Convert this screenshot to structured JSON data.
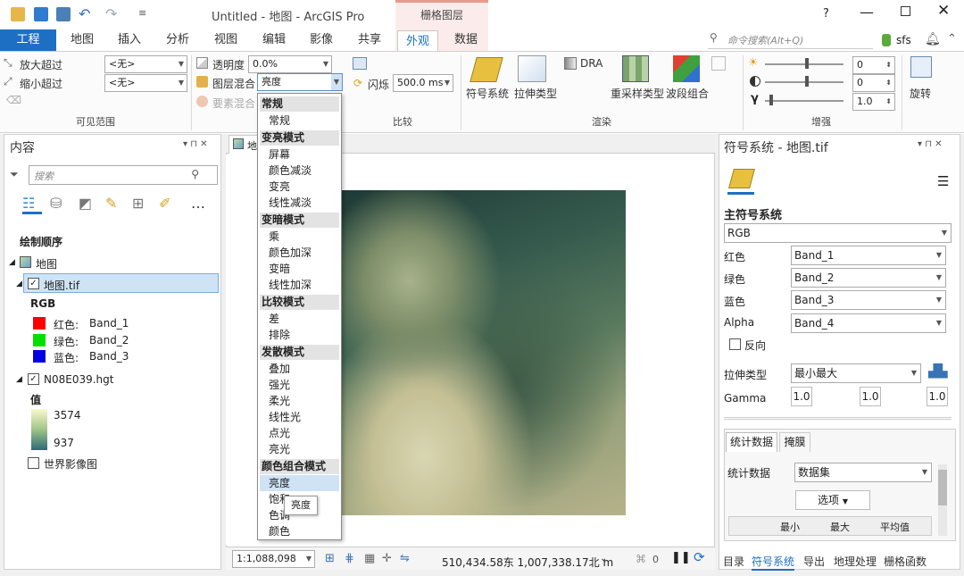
{
  "app": {
    "title": "Untitled - 地图 - ArcGIS Pro",
    "context_tab": "栅格图层",
    "help": "?"
  },
  "tabs": [
    "工程",
    "地图",
    "插入",
    "分析",
    "视图",
    "编辑",
    "影像",
    "共享",
    "外观",
    "数据"
  ],
  "search": {
    "placeholder": "命令搜索(Alt+Q)"
  },
  "user": "sfs",
  "ribbon": {
    "zoom_in_label": "放大超过",
    "zoom_out_label": "缩小超过",
    "zoom_in_value": "<无>",
    "zoom_out_value": "<无>",
    "visible_range_title": "可见范围",
    "transparency_label": "透明度",
    "transparency_value": "0.0%",
    "layer_blend_label": "图层混合",
    "layer_blend_value": "亮度",
    "feature_blend_label": "要素混合",
    "flicker_label": "闪烁",
    "flicker_value": "500.0",
    "flicker_unit": "ms",
    "compare_title": "比较",
    "symbology_label": "符号系统",
    "stretch_label": "拉伸类型",
    "dra_label": "DRA",
    "resample_label": "重采样类型",
    "band_combo_label": "波段组合",
    "render_title": "渲染",
    "brightness": "0",
    "contrast": "0",
    "gamma": "1.0",
    "enhance_title": "增强",
    "rotate_label": "旋转"
  },
  "contents": {
    "title": "内容",
    "search_placeholder": "搜索",
    "draw_order": "绘制顺序",
    "map": "地图",
    "layer1": "地图.tif",
    "rgb": "RGB",
    "bands": [
      {
        "label": "红色:",
        "band": "Band_1",
        "color": "#ff0000"
      },
      {
        "label": "绿色:",
        "band": "Band_2",
        "color": "#00e000"
      },
      {
        "label": "蓝色:",
        "band": "Band_3",
        "color": "#0000e0"
      }
    ],
    "layer2": "N08E039.hgt",
    "value_label": "值",
    "high": "3574",
    "low": "937",
    "layer3": "世界影像图"
  },
  "map_tab": "地",
  "blend_menu": {
    "sections": [
      {
        "header": "常规",
        "items": [
          "常规"
        ]
      },
      {
        "header": "变亮模式",
        "items": [
          "屏幕",
          "颜色减淡",
          "变亮",
          "线性减淡"
        ]
      },
      {
        "header": "变暗模式",
        "items": [
          "乘",
          "颜色加深",
          "变暗",
          "线性加深"
        ]
      },
      {
        "header": "比较模式",
        "items": [
          "差",
          "排除"
        ]
      },
      {
        "header": "发散模式",
        "items": [
          "叠加",
          "强光",
          "柔光",
          "线性光",
          "点光",
          "亮光"
        ]
      },
      {
        "header": "颜色组合模式",
        "items": [
          "亮度",
          "饱和",
          "色调",
          "颜色"
        ]
      }
    ],
    "tooltip": "亮度"
  },
  "status": {
    "scale": "1:1,088,098",
    "coords": "510,434.58东 1,007,338.17北 m",
    "count": "0"
  },
  "symbology": {
    "title": "符号系统 - 地图.tif",
    "primary": "主符号系统",
    "renderer": "RGB",
    "channels": [
      {
        "label": "红色",
        "band": "Band_1"
      },
      {
        "label": "绿色",
        "band": "Band_2"
      },
      {
        "label": "蓝色",
        "band": "Band_3"
      },
      {
        "label": "Alpha",
        "band": "Band_4"
      }
    ],
    "invert": "反向",
    "stretch_label": "拉伸类型",
    "stretch_value": "最小最大",
    "gamma_label": "Gamma",
    "gamma_values": [
      "1.0",
      "1.0",
      "1.0"
    ],
    "tabs": [
      "统计数据",
      "掩膜"
    ],
    "stats_label": "统计数据",
    "stats_value": "数据集",
    "options": "选项",
    "table_headers": [
      "最小",
      "最大",
      "平均值"
    ]
  },
  "bottom_tabs": [
    "目录",
    "符号系统",
    "导出",
    "地理处理",
    "栅格函数"
  ],
  "colors": {
    "accent": "#1d6fc4",
    "context": "#e8998b"
  }
}
